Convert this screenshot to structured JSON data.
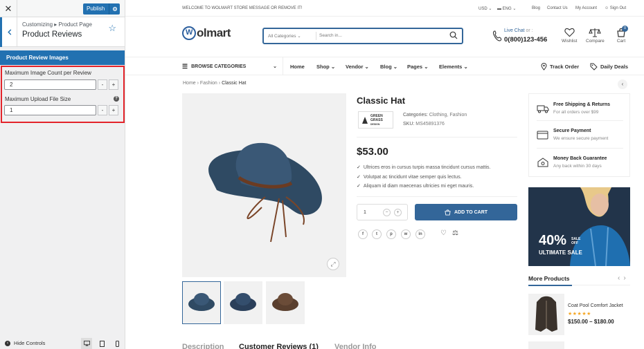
{
  "customizer": {
    "close_icon": "✕",
    "publish_label": "Publish",
    "breadcrumb": "Customizing ▸ Product Page",
    "panel_title": "Product Reviews",
    "section_title": "Product Review Images",
    "fields": [
      {
        "label": "Maximum Image Count per Review",
        "value": "2"
      },
      {
        "label": "Maximum Upload File Size",
        "value": "1"
      }
    ],
    "minus": "-",
    "plus": "+",
    "help": "?",
    "hide_controls": "Hide Controls"
  },
  "topbar": {
    "welcome": "WELCOME TO WOLMART STORE MESSAGE OR REMOVE IT!",
    "currency": "USD",
    "language": "ENG",
    "links": [
      "Blog",
      "Contact Us",
      "My Account"
    ],
    "signout": "Sign Out"
  },
  "header": {
    "logo_mark": "W",
    "logo_text": "olmart",
    "search_category": "All Categories",
    "search_placeholder": "Search in...",
    "live_chat": "Live Chat",
    "or": "or :",
    "phone": "0(800)123-456",
    "wishlist": "Wishlist",
    "compare": "Compare",
    "cart": "Cart",
    "cart_count": "0"
  },
  "nav": {
    "browse": "BROWSE CATEGORIES",
    "items": [
      "Home",
      "Shop",
      "Vendor",
      "Blog",
      "Pages",
      "Elements"
    ],
    "track_order": "Track Order",
    "daily_deals": "Daily Deals"
  },
  "breadcrumb": [
    "Home",
    "Fashion",
    "Classic Hat"
  ],
  "product": {
    "title": "Classic Hat",
    "brand_top": "GREEN",
    "brand_mid": "GRASS",
    "brand_bot": "DESIGN",
    "categories_label": "Categories:",
    "categories": "Clothing, Fashion",
    "sku_label": "SKU:",
    "sku": "MS45891376",
    "price": "$53.00",
    "features": [
      "Ultrices eros in cursus turpis massa tincidunt cursus mattis.",
      "Volutpat ac tincidunt vitae semper quis lectus.",
      "Aliquam id diam maecenas ultricies mi eget mauris."
    ],
    "qty": "1",
    "add_to_cart": "ADD TO CART",
    "social": [
      "f",
      "t",
      "p",
      "w",
      "in"
    ]
  },
  "services": [
    {
      "title": "Free Shipping & Returns",
      "sub": "For all orders over $99"
    },
    {
      "title": "Secure Payment",
      "sub": "We ensure secure payment"
    },
    {
      "title": "Money Back Guarantee",
      "sub": "Any back within 30 days"
    }
  ],
  "banner": {
    "big": "40%",
    "off_top": "SALE",
    "off_bot": "OFF",
    "sale": "ULTIMATE SALE"
  },
  "more_products": {
    "title": "More Products",
    "item": {
      "name": "Coat Pool Comfort Jacket",
      "stars": "★★★★★",
      "price": "$150.00 – $180.00"
    }
  },
  "tabs": [
    "Description",
    "Customer Reviews (1)",
    "Vendor Info"
  ],
  "colors": {
    "wp_blue": "#2271b1",
    "brand": "#336699",
    "highlight": "#e3232a"
  }
}
